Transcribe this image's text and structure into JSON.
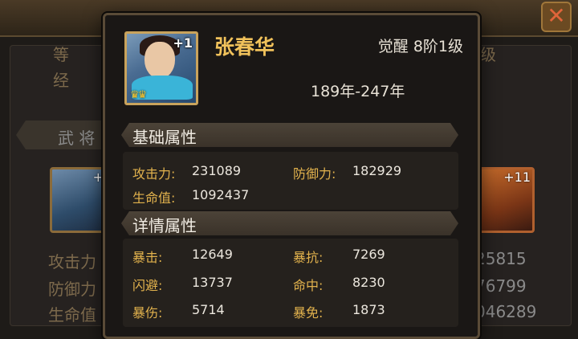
{
  "background": {
    "left_labels": [
      "等",
      "经"
    ],
    "right_label": "级",
    "section_tab": "武 将",
    "attr_labels": [
      "攻击力",
      "防御力",
      "生命值"
    ],
    "attr_values": [
      "25815",
      "76799",
      "046289"
    ],
    "portrait_plus": "+",
    "red_portrait_level": "+11",
    "close_glyph": "✕"
  },
  "hero": {
    "name": "张春华",
    "level_badge": "+1",
    "awaken": "觉醒 8阶1级",
    "years": "189年-247年",
    "crowns": "♛♛"
  },
  "basic": {
    "title": "基础属性",
    "stats": [
      {
        "label": "攻击力:",
        "value": "231089"
      },
      {
        "label": "防御力:",
        "value": "182929"
      },
      {
        "label": "生命值:",
        "value": "1092437"
      }
    ]
  },
  "detail": {
    "title": "详情属性",
    "stats": [
      {
        "label": "暴击:",
        "value": "12649"
      },
      {
        "label": "暴抗:",
        "value": "7269"
      },
      {
        "label": "闪避:",
        "value": "13737"
      },
      {
        "label": "命中:",
        "value": "8230"
      },
      {
        "label": "暴伤:",
        "value": "5714"
      },
      {
        "label": "暴免:",
        "value": "1873"
      }
    ]
  }
}
